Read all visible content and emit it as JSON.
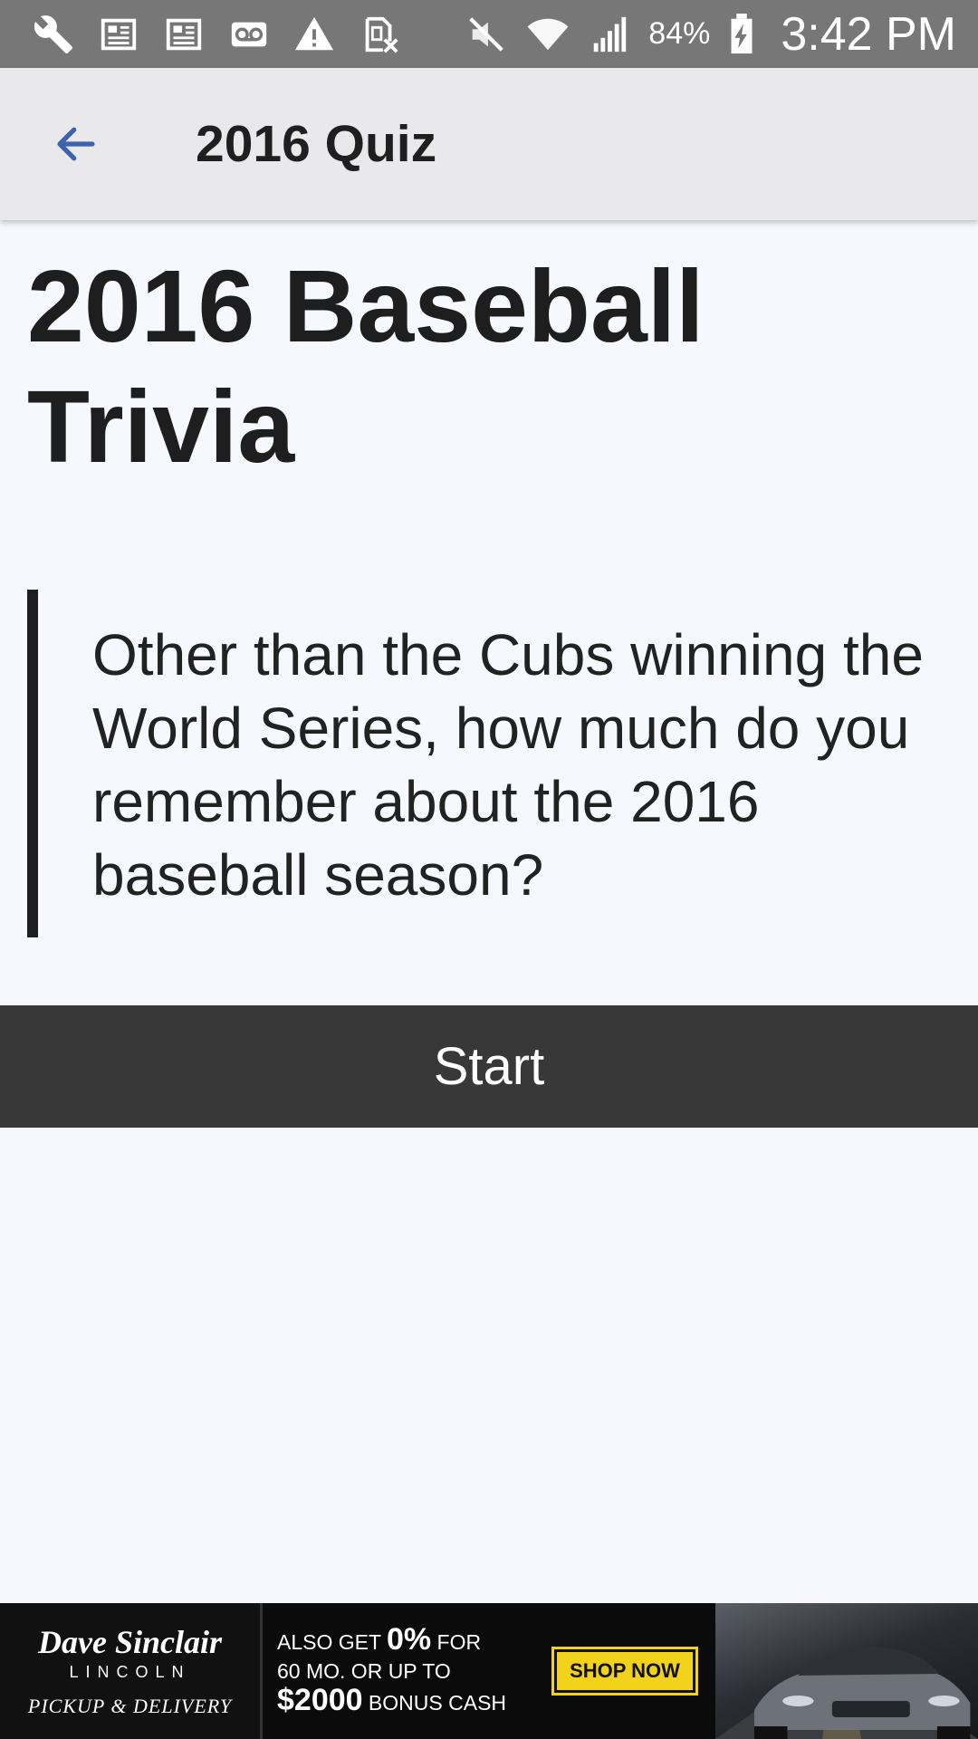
{
  "status_bar": {
    "icons": [
      "wrench-icon",
      "news-icon",
      "news-icon",
      "voicemail-icon",
      "warning-icon",
      "sim-icon",
      "mute-icon",
      "wifi-icon",
      "signal-icon",
      "battery-charging-icon"
    ],
    "battery": "84%",
    "time": "3:42 PM"
  },
  "app_bar": {
    "back_icon": "arrow-left-icon",
    "title": "2016 Quiz"
  },
  "main": {
    "heading": "2016 Baseball Trivia",
    "intro": "Other than the Cubs winning the World Series, how much do you remember about the 2016 baseball season?",
    "start_label": "Start"
  },
  "ad": {
    "brand": "Dave Sinclair",
    "make": "LINCOLN",
    "service": "PICKUP & DELIVERY",
    "offer_line1_prefix": "ALSO GET ",
    "offer_line1_value": "0%",
    "offer_line1_suffix": " FOR",
    "offer_line2": "60 MO. OR UP TO",
    "offer_line3_value": "$2000",
    "offer_line3_suffix": " BONUS CASH",
    "cta": "SHOP NOW"
  },
  "colors": {
    "status_bar": "#777777",
    "app_bar": "#e9e9eb",
    "background": "#f7f8fd",
    "accent_back_arrow": "#3f63a8",
    "start_button": "#383838",
    "cta": "#f2d21a"
  }
}
